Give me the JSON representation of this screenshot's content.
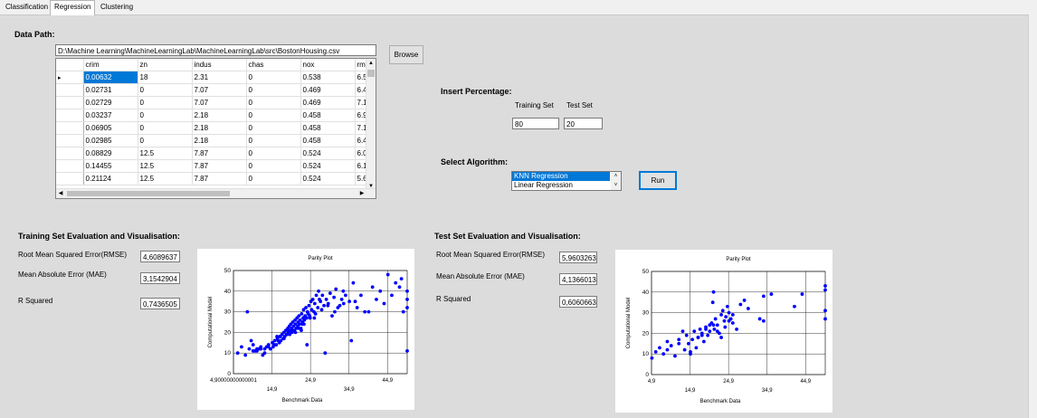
{
  "tabs": [
    {
      "label": "Classification",
      "active": false
    },
    {
      "label": "Regression",
      "active": true
    },
    {
      "label": "Clustering",
      "active": false
    }
  ],
  "data_path": {
    "label": "Data Path:",
    "value": "D:\\Machine Learning\\MachineLearningLab\\MachineLearningLab\\src\\BostonHousing.csv",
    "browse_label": "Browse"
  },
  "grid": {
    "columns": [
      "crim",
      "zn",
      "indus",
      "chas",
      "nox",
      "rm"
    ],
    "rows": [
      [
        "0.00632",
        "18",
        "2.31",
        "0",
        "0.538",
        "6.5"
      ],
      [
        "0.02731",
        "0",
        "7.07",
        "0",
        "0.469",
        "6.4"
      ],
      [
        "0.02729",
        "0",
        "7.07",
        "0",
        "0.469",
        "7.1"
      ],
      [
        "0.03237",
        "0",
        "2.18",
        "0",
        "0.458",
        "6.9"
      ],
      [
        "0.06905",
        "0",
        "2.18",
        "0",
        "0.458",
        "7.1"
      ],
      [
        "0.02985",
        "0",
        "2.18",
        "0",
        "0.458",
        "6.4"
      ],
      [
        "0.08829",
        "12.5",
        "7.87",
        "0",
        "0.524",
        "6.0"
      ],
      [
        "0.14455",
        "12.5",
        "7.87",
        "0",
        "0.524",
        "6.1"
      ],
      [
        "0.21124",
        "12.5",
        "7.87",
        "0",
        "0.524",
        "5.6"
      ]
    ]
  },
  "percentage": {
    "label": "Insert Percentage:",
    "training_label": "Training Set",
    "test_label": "Test Set",
    "training_value": "80",
    "test_value": "20"
  },
  "algorithm": {
    "label": "Select Algorithm:",
    "options": [
      "KNN Regression",
      "Linear Regression"
    ],
    "selected": "KNN Regression",
    "run_label": "Run"
  },
  "training_eval": {
    "title": "Training Set Evaluation and Visualisation:",
    "rmse_label": "Root Mean Squared Error(RMSE)",
    "rmse_value": "4,6089637",
    "mae_label": "Mean Absolute Error (MAE)",
    "mae_value": "3,1542904",
    "r2_label": "R Squared",
    "r2_value": "0,7436505"
  },
  "test_eval": {
    "title": "Test Set Evaluation and Visualisation:",
    "rmse_label": "Root Mean Squared Error(RMSE)",
    "rmse_value": "5,9603263",
    "mae_label": "Mean Absolute Error (MAE)",
    "mae_value": "4,1366013",
    "r2_label": "R Squared",
    "r2_value": "0,6060663"
  },
  "chart_data": [
    {
      "type": "scatter",
      "title": "Parity Plot",
      "xlabel": "Benchmark Data",
      "ylabel": "Computational Model",
      "xlim": [
        4.9,
        50
      ],
      "ylim": [
        0,
        50
      ],
      "x_ticks": [
        "4,90000000000001",
        "14,9",
        "24,9",
        "34,9",
        "44,9"
      ],
      "x_tick_values": [
        4.9,
        14.9,
        24.9,
        34.9,
        44.9
      ],
      "y_ticks": [
        0,
        10,
        20,
        30,
        40,
        50
      ],
      "grid": true,
      "color": "#0000ff",
      "x": [
        6,
        7,
        8,
        9,
        10,
        11,
        12,
        13,
        13.5,
        14,
        14.5,
        15,
        15.2,
        15.6,
        16,
        16.3,
        16.8,
        17,
        17.2,
        17.5,
        17.8,
        18,
        18.2,
        18.5,
        18.8,
        19,
        19.2,
        19.4,
        19.6,
        19.8,
        20,
        20.1,
        20.3,
        20.5,
        20.7,
        20.9,
        21,
        21.2,
        21.4,
        21.6,
        21.7,
        21.9,
        22,
        22.2,
        22.4,
        22.6,
        22.8,
        23,
        23.1,
        23.3,
        23.5,
        23.7,
        23.9,
        24.1,
        24.3,
        24.5,
        24.7,
        25,
        25.2,
        25.5,
        25.8,
        26,
        26.4,
        26.8,
        27,
        27.5,
        28,
        28.4,
        29,
        29.5,
        30,
        31,
        31.5,
        32,
        33,
        33.4,
        34,
        35,
        36,
        37,
        38,
        39,
        41,
        42,
        43,
        44,
        45,
        46,
        47,
        48,
        48.5,
        49,
        50,
        50,
        50,
        50,
        13,
        14,
        15.5,
        16.5,
        18,
        19.5,
        21,
        22.5,
        24,
        12,
        11,
        10,
        9.5,
        17,
        18.7,
        20.2,
        21.8,
        23.2,
        24.8,
        26.2,
        27.8,
        29.4,
        31.2,
        33.5,
        35.5,
        16.2,
        19.1,
        22.7,
        25.9,
        28.7,
        10.5,
        11.5,
        12.5,
        8.5,
        27.2,
        30.5,
        32.5,
        36.5,
        40,
        44.5
      ],
      "y": [
        10,
        13,
        9,
        12,
        14,
        11,
        12,
        10,
        13,
        14,
        12,
        15,
        13,
        16,
        14,
        17,
        15,
        18,
        16,
        19,
        17,
        20,
        18,
        21,
        19,
        22,
        20,
        23,
        21,
        24,
        22,
        20,
        25,
        23,
        21,
        26,
        24,
        22,
        27,
        23,
        25,
        28,
        24,
        26,
        22,
        29,
        25,
        27,
        31,
        26,
        28,
        32,
        27,
        30,
        29,
        33,
        28,
        35,
        31,
        36,
        30,
        34,
        38,
        32,
        40,
        35,
        38,
        33,
        36,
        34,
        39,
        37,
        41,
        32,
        36,
        40,
        38,
        35,
        44,
        32,
        38,
        30,
        42,
        36,
        40,
        34,
        48,
        38,
        44,
        42,
        46,
        30,
        36,
        40,
        32,
        11,
        12,
        13,
        14,
        16,
        17,
        19,
        20,
        21,
        14,
        13,
        12,
        11,
        16,
        18,
        19,
        21,
        22,
        24,
        27,
        29,
        31,
        33,
        30,
        34,
        16,
        18,
        21,
        24,
        27,
        10,
        11,
        12,
        9,
        30,
        36,
        28,
        33,
        35,
        30
      ]
    },
    {
      "type": "scatter",
      "title": "Parity Plot",
      "xlabel": "Benchmark Data",
      "ylabel": "Computational Model",
      "xlim": [
        4.9,
        50
      ],
      "ylim": [
        0,
        50
      ],
      "x_ticks": [
        "4,9",
        "14,9",
        "24,9",
        "34,9",
        "44,9"
      ],
      "x_tick_values": [
        4.9,
        14.9,
        24.9,
        34.9,
        44.9
      ],
      "y_ticks": [
        0,
        10,
        20,
        30,
        40,
        50
      ],
      "grid": true,
      "color": "#0000ff",
      "x": [
        5,
        6,
        7,
        8,
        9,
        10,
        11,
        12,
        13,
        13.5,
        14,
        14.5,
        15,
        15.5,
        16,
        16.5,
        17,
        17.5,
        18,
        18.5,
        19,
        19.5,
        20,
        20.5,
        21,
        21.2,
        21.5,
        22,
        22.5,
        23,
        23.4,
        23.8,
        24.2,
        24.6,
        25,
        25.5,
        26,
        27,
        28,
        29,
        30,
        33,
        34,
        34,
        36,
        42,
        44,
        50,
        50,
        50,
        50,
        9,
        12,
        15,
        17,
        20,
        22,
        24,
        26,
        18,
        19,
        21,
        23,
        25,
        20.8
      ],
      "y": [
        8,
        11,
        13,
        10,
        12,
        14,
        9,
        17,
        21,
        12,
        19,
        15,
        11,
        17,
        21,
        13,
        18,
        22,
        20,
        16,
        23,
        19,
        21,
        25,
        40,
        22,
        27,
        24,
        20,
        29,
        31,
        26,
        28,
        33,
        30,
        27,
        25,
        22,
        34,
        36,
        32,
        27,
        38,
        26,
        39,
        33,
        39,
        43,
        41,
        31,
        27,
        16,
        15,
        10,
        18,
        24,
        21,
        23,
        29,
        19,
        22,
        24,
        18,
        26,
        35
      ]
    }
  ]
}
